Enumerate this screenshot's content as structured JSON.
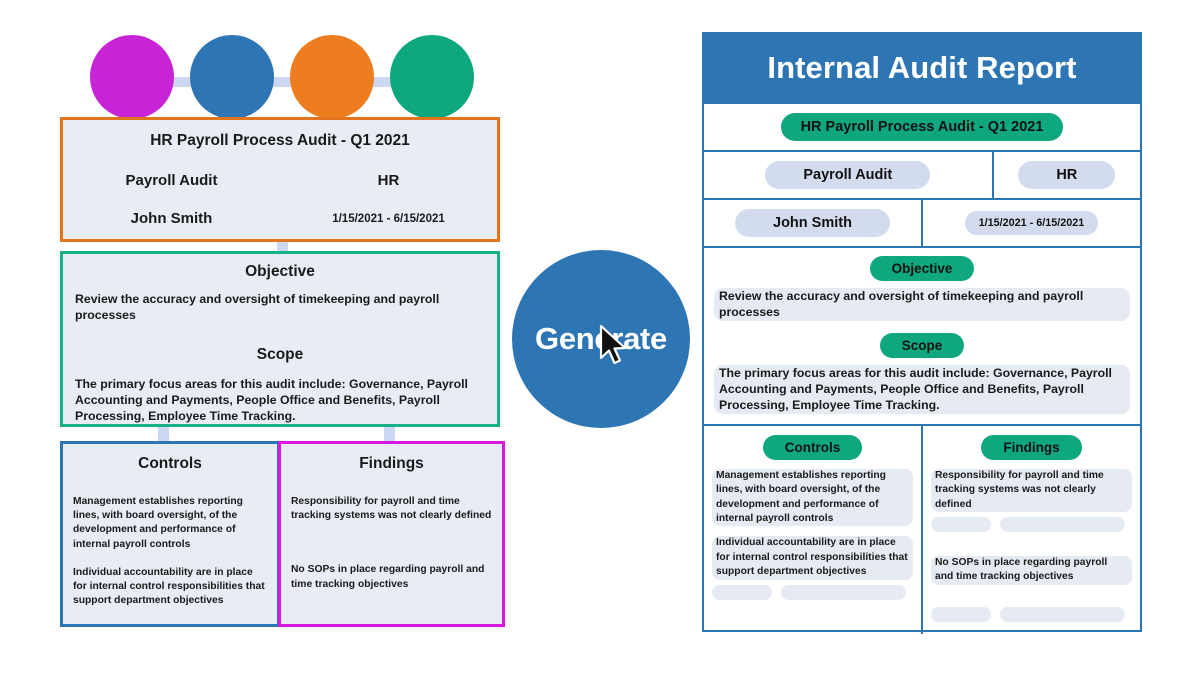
{
  "flow": {
    "nodes": [
      {
        "name": "node-magenta",
        "color": "#c724d6"
      },
      {
        "name": "node-blue",
        "color": "#2d76b3"
      },
      {
        "name": "node-orange",
        "color": "#ed7d1e"
      },
      {
        "name": "node-green",
        "color": "#0fa77e"
      }
    ]
  },
  "source": {
    "meta": {
      "title": "HR Payroll Process Audit - Q1 2021",
      "audit_type": "Payroll Audit",
      "department": "HR",
      "auditor": "John Smith",
      "date_range": "1/15/2021 - 6/15/2021"
    },
    "objective": {
      "heading": "Objective",
      "body": "Review the accuracy and oversight of timekeeping and payroll processes"
    },
    "scope": {
      "heading": "Scope",
      "body": "The primary focus areas for this audit include: Governance, Payroll Accounting and Payments, People Office and Benefits, Payroll Processing, Employee Time Tracking."
    },
    "controls": {
      "heading": "Controls",
      "items": [
        "Management establishes reporting lines, with board oversight, of the development and performance of internal payroll controls",
        "Individual accountability are in place for internal control responsibilities that support department objectives"
      ]
    },
    "findings": {
      "heading": "Findings",
      "items": [
        "Responsibility for payroll and time tracking systems was not clearly defined",
        "No SOPs in place regarding payroll and time tracking objectives"
      ]
    }
  },
  "generate": {
    "label": "Generate",
    "color": "#2d76b3",
    "cursor_icon": "mouse-pointer-icon"
  },
  "report": {
    "title": "Internal Audit Report",
    "header_color": "#2d76b3",
    "pill_green": "#0fa77e",
    "pill_blue": "#d3dcee",
    "meta": {
      "title": "HR Payroll Process Audit - Q1 2021",
      "audit_type": "Payroll Audit",
      "department": "HR",
      "auditor": "John Smith",
      "date_range": "1/15/2021 - 6/15/2021"
    },
    "objective": {
      "heading": "Objective",
      "body": "Review the accuracy and oversight of timekeeping and payroll processes"
    },
    "scope": {
      "heading": "Scope",
      "body": "The primary focus areas for this audit include: Governance, Payroll Accounting and Payments, People Office and Benefits, Payroll Processing, Employee Time Tracking."
    },
    "controls": {
      "heading": "Controls",
      "items": [
        "Management establishes reporting lines, with board oversight, of the development and performance of internal payroll controls",
        "Individual accountability are in place for internal control responsibilities that support department objectives"
      ]
    },
    "findings": {
      "heading": "Findings",
      "items": [
        "Responsibility for payroll and time tracking systems was not clearly defined",
        "No SOPs in place regarding payroll and time tracking objectives"
      ]
    }
  }
}
